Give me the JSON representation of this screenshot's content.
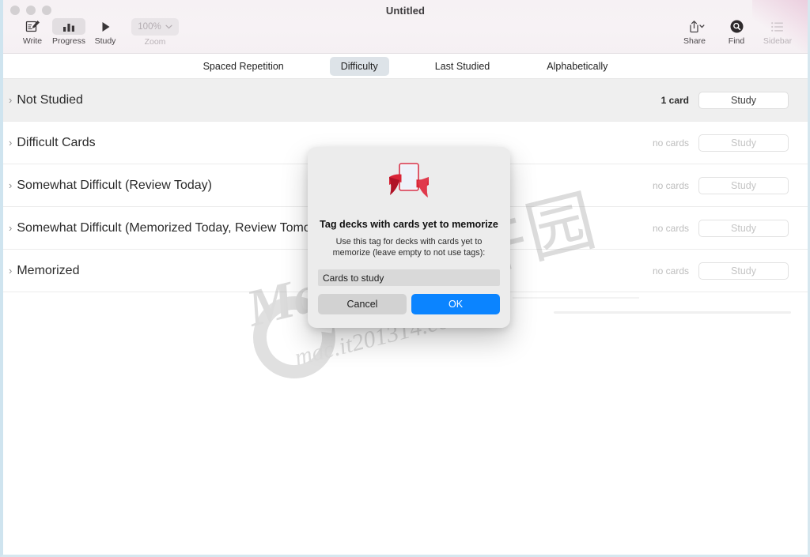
{
  "window": {
    "title": "Untitled",
    "traffic_lights": [
      "close",
      "minimize",
      "zoom"
    ]
  },
  "toolbar": {
    "left_items": [
      {
        "label": "Write",
        "icon": "write-pencil-icon",
        "selected": false
      },
      {
        "label": "Progress",
        "icon": "bar-chart-icon",
        "selected": true
      },
      {
        "label": "Study",
        "icon": "play-triangle-icon",
        "selected": false
      }
    ],
    "zoom": {
      "value": "100%",
      "label": "Zoom",
      "icon": "chevron-down-icon"
    },
    "right_items": [
      {
        "label": "Share",
        "icon": "share-icon",
        "dim": false
      },
      {
        "label": "Find",
        "icon": "find-magnifier-icon",
        "dim": false
      },
      {
        "label": "Sidebar",
        "icon": "sidebar-list-icon",
        "dim": true
      }
    ]
  },
  "tabs": [
    {
      "label": "Spaced Repetition",
      "active": false
    },
    {
      "label": "Difficulty",
      "active": true
    },
    {
      "label": "Last Studied",
      "active": false
    },
    {
      "label": "Alphabetically",
      "active": false
    }
  ],
  "decks": [
    {
      "title": "Not Studied",
      "count": "1 card",
      "action": "Study",
      "highlight": true,
      "has_cards": true
    },
    {
      "title": "Difficult Cards",
      "count": "no cards",
      "action": "Study",
      "highlight": false,
      "has_cards": false
    },
    {
      "title": "Somewhat Difficult (Review Today)",
      "count": "no cards",
      "action": "Study",
      "highlight": false,
      "has_cards": false
    },
    {
      "title": "Somewhat Difficult (Memorized Today, Review Tomorrow)",
      "count": "no cards",
      "action": "Study",
      "highlight": false,
      "has_cards": false
    },
    {
      "title": "Memorized",
      "count": "no cards",
      "action": "Study",
      "highlight": false,
      "has_cards": false
    }
  ],
  "dialog": {
    "icon": "card-with-red-ribbon-icon",
    "title": "Tag decks with cards yet to memorize",
    "message": "Use this tag for decks with cards yet to memorize (leave empty to not use tags):",
    "input_value": "Cards to study",
    "input_placeholder": "",
    "cancel_label": "Cancel",
    "ok_label": "OK",
    "ok_color": "#0b84ff"
  },
  "watermark": {
    "cjk": "软件园",
    "latin": "Mac",
    "url": "mac.it201314.com"
  }
}
